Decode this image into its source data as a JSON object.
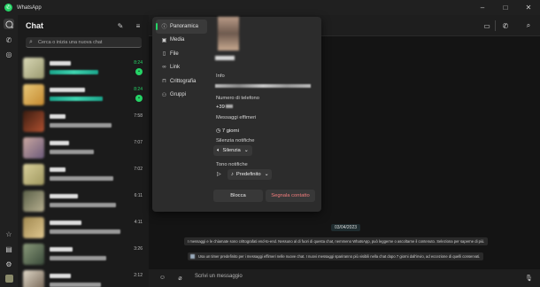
{
  "window": {
    "title": "WhatsApp"
  },
  "sidebar": {
    "heading": "Chat"
  },
  "search": {
    "placeholder": "Cerca o inizia una nuova chat"
  },
  "chats": [
    {
      "time": "8:24",
      "unread": true,
      "time_color": "green"
    },
    {
      "time": "8:24",
      "unread": true,
      "time_color": "green"
    },
    {
      "time": "7:58",
      "unread": false
    },
    {
      "time": "7:07",
      "unread": false
    },
    {
      "time": "7:02",
      "unread": false
    },
    {
      "time": "6:11",
      "unread": false
    },
    {
      "time": "4:11",
      "unread": false
    },
    {
      "time": "3:26",
      "unread": false
    },
    {
      "time": "2:12",
      "unread": false
    }
  ],
  "popup": {
    "nav": [
      {
        "label": "Panoramica",
        "icon": "info-icon",
        "active": true
      },
      {
        "label": "Media",
        "icon": "image-icon"
      },
      {
        "label": "File",
        "icon": "file-icon"
      },
      {
        "label": "Link",
        "icon": "link-icon"
      },
      {
        "label": "Crittografia",
        "icon": "lock-icon"
      },
      {
        "label": "Gruppi",
        "icon": "group-icon"
      }
    ],
    "info_label": "Info",
    "phone_label": "Numero di telefono",
    "phone_value": "+39",
    "disappearing_label": "Messaggi effimeri",
    "disappearing_value": "7 giorni",
    "mute_label": "Silenzia notifiche",
    "mute_value": "Silenzia",
    "tone_label": "Tono notifiche",
    "tone_value": "Predefinito",
    "block_button": "Blocca",
    "report_button": "Segnala contatto"
  },
  "conversation": {
    "date": "03/04/2023",
    "system_messages": [
      "I messaggi e le chiamate sono crittografati end-to-end. Nessuno al di fuori di questa chat, nemmeno WhatsApp, può leggerne o ascoltarne il contenuto. Seleziona per saperne di più.",
      "Usa un timer predefinito per i messaggi effimeri nelle nuove chat. I nuovi messaggi spariranno più visibili nella chat dopo 7 giorni dall'invio, ad eccezione di quelli conservati."
    ],
    "composer_placeholder": "Scrivi un messaggio"
  },
  "colors": {
    "accent": "#25d366",
    "danger": "#f27d7d",
    "background": "#141414"
  }
}
